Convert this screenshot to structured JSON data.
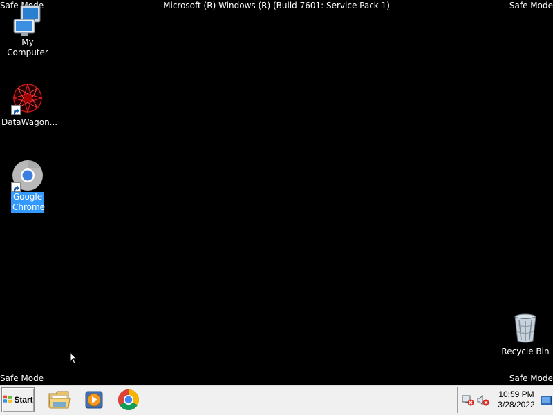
{
  "desktop": {
    "safe_mode_label": "Safe Mode",
    "build_banner": "Microsoft (R) Windows (R) (Build 7601: Service Pack 1)",
    "background_color": "#000000",
    "icons": [
      {
        "label": "My Computer",
        "icon": "computer-icon"
      },
      {
        "label": "DataWagon...",
        "icon": "datawagon-icon"
      },
      {
        "label": "Google Chrome",
        "icon": "chrome-icon",
        "selected": true
      },
      {
        "label": "Recycle Bin",
        "icon": "recycle-bin-icon"
      }
    ]
  },
  "taskbar": {
    "start_label": "Start",
    "pinned": [
      {
        "icon": "windows-explorer-icon"
      },
      {
        "icon": "media-player-icon"
      },
      {
        "icon": "chrome-icon"
      }
    ],
    "tray": {
      "network_icon": "network-disconnected-icon",
      "volume_icon": "volume-muted-icon",
      "time": "10:59 PM",
      "date": "3/28/2022"
    }
  },
  "colors": {
    "selection": "#3399ff",
    "taskbar": "#f0f0f0"
  }
}
